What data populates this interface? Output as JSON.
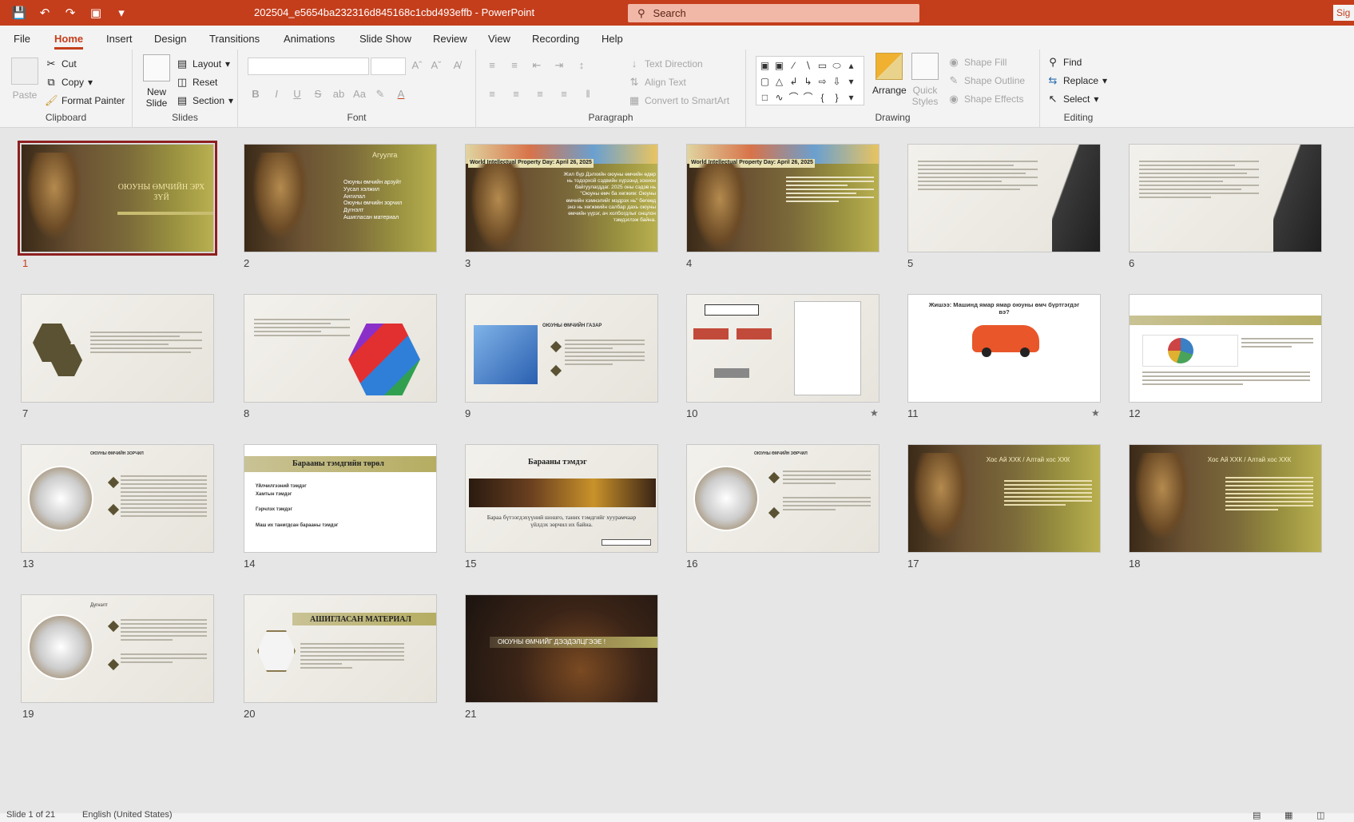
{
  "window": {
    "doc_title": "202504_e5654ba232316d845168c1cbd493effb  -  PowerPoint",
    "search_placeholder": "Search",
    "signin": "Sig"
  },
  "menu": {
    "tabs": [
      "File",
      "Home",
      "Insert",
      "Design",
      "Transitions",
      "Animations",
      "Slide Show",
      "Review",
      "View",
      "Recording",
      "Help"
    ],
    "active": "Home"
  },
  "ribbon": {
    "clipboard": {
      "label": "Clipboard",
      "paste": "Paste",
      "cut": "Cut",
      "copy": "Copy",
      "format_painter": "Format Painter"
    },
    "slides": {
      "label": "Slides",
      "new_slide": "New Slide",
      "layout": "Layout",
      "reset": "Reset",
      "section": "Section"
    },
    "font": {
      "label": "Font"
    },
    "paragraph": {
      "label": "Paragraph",
      "text_direction": "Text Direction",
      "align_text": "Align Text",
      "convert_smartart": "Convert to SmartArt"
    },
    "drawing": {
      "label": "Drawing",
      "arrange": "Arrange",
      "quick_styles": "Quick Styles",
      "shape_fill": "Shape Fill",
      "shape_outline": "Shape Outline",
      "shape_effects": "Shape Effects"
    },
    "editing": {
      "label": "Editing",
      "find": "Find",
      "replace": "Replace",
      "select": "Select"
    }
  },
  "slides": [
    {
      "n": "1",
      "title": "ОЮУНЫ ӨМЧИЙН ЭРХ ЗҮЙ"
    },
    {
      "n": "2",
      "title": "Агуулга",
      "items": [
        "Оюуны өмчийн арзуйт",
        "Уусал хэлжил",
        "Ангилал",
        "Оюуны өмчийн зорчил",
        "Дүгнэлт",
        "Ашигласан материал"
      ]
    },
    {
      "n": "3",
      "title": "World Intellectual Property Day: April 26, 2025",
      "body": "Жил бүр Дэлхийн оюуны өмчийн өдөр нь тодорхой сэдвийн хүрээнд зохион байгуулагддаг. 2025 оны сэдэв нь \"Оюуны өмч ба хөгжим: Оюуны өмчийн хэмнэлийг мэдрэх нь\" бөгөөд энэ нь хөгжмийн салбар дахь оюуны өмчийн үүрэг, ач холбогдлыг онцлон тэмдэглэж байна."
    },
    {
      "n": "4",
      "title": "World Intellectual Property Day: April 26, 2025"
    },
    {
      "n": "5",
      "title": ""
    },
    {
      "n": "6",
      "title": ""
    },
    {
      "n": "7",
      "title": ""
    },
    {
      "n": "8",
      "title": ""
    },
    {
      "n": "9",
      "title": "ОЮУНЫ ӨМЧИЙН ГАЗАР"
    },
    {
      "n": "10",
      "title": "",
      "star": true
    },
    {
      "n": "11",
      "title": "Жишээ: Машинд ямар ямар оюуны өмч бүртгэгдэг вэ?",
      "star": true
    },
    {
      "n": "12",
      "title": ""
    },
    {
      "n": "13",
      "title": "ОЮУНЫ ӨМЧИЙН ЗОРЧИЛ"
    },
    {
      "n": "14",
      "title": "Барааны тэмдгийн төрөл",
      "items": [
        "Үйлчилгээний тэмдэг",
        "Хамтын тэмдэг",
        "Гэрчлэх тэмдэг",
        "Маш их танигдсан барааны тэмдэг"
      ]
    },
    {
      "n": "15",
      "title": "Барааны тэмдэг",
      "body": "Бараа бүтээгдэхүүний шошго, таних тэмдгийг хуурамчаар үйлдэх зөрчил их байна."
    },
    {
      "n": "16",
      "title": "ОЮУНЫ ӨМЧИЙН ЗӨРЧИЛ"
    },
    {
      "n": "17",
      "title": "Хос Ай ХХК / Алтай хос ХХК"
    },
    {
      "n": "18",
      "title": "Хос Ай ХХК / Алтай хос ХХК"
    },
    {
      "n": "19",
      "title": "Дүгнэлт"
    },
    {
      "n": "20",
      "title": "АШИГЛАСАН МАТЕРИАЛ"
    },
    {
      "n": "21",
      "title": "ОЮУНЫ ӨМЧИЙГ ДЭЭДЭЛЦГЭЭЕ !"
    }
  ],
  "status": {
    "slide_of": "Slide 1 of 21",
    "language": "English (United States)"
  },
  "colors": {
    "accent": "#c43e1c",
    "selection": "#8e1f1f"
  }
}
